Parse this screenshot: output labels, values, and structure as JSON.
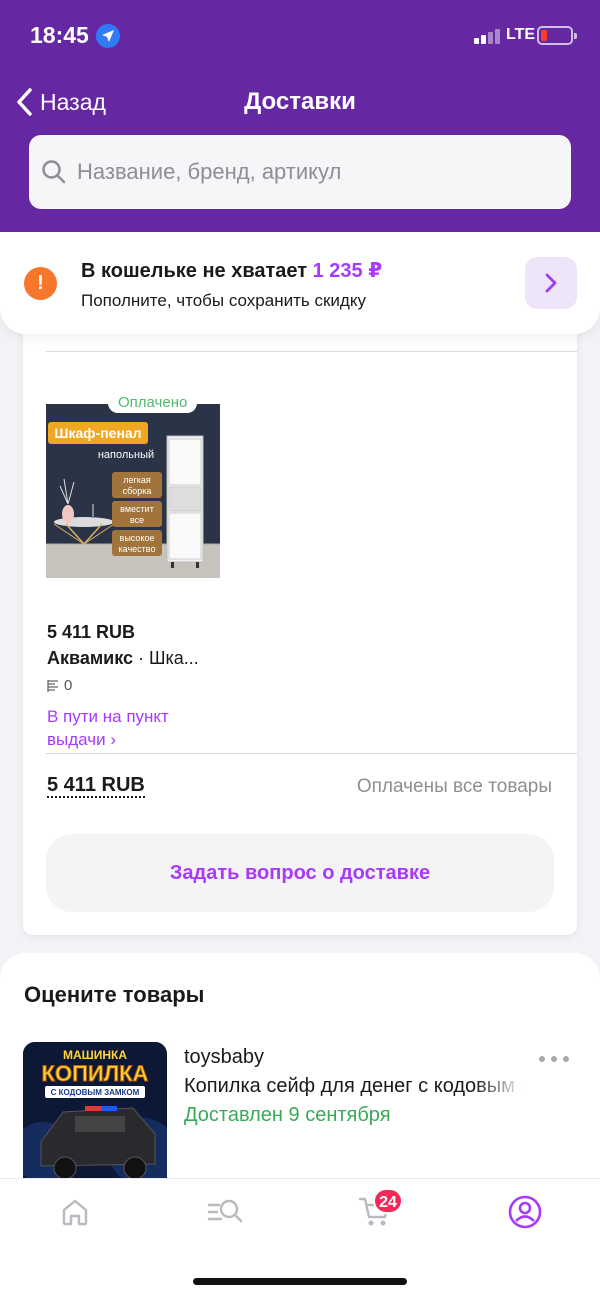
{
  "status_bar": {
    "time": "18:45",
    "network": "LTE"
  },
  "header": {
    "back_label": "Назад",
    "title": "Доставки",
    "search_placeholder": "Название, бренд, артикул"
  },
  "wallet_banner": {
    "title": "В кошельке не хватает",
    "amount": "1 235 ₽",
    "subtitle": "Пополните, чтобы сохранить скидку",
    "icon": "warning-icon"
  },
  "order": {
    "badge": "Оплачено",
    "image_texts": {
      "title": "Шкаф-пенал",
      "subtitle": "напольный",
      "tags": [
        "легкая сборка",
        "вместит все",
        "высокое качество"
      ]
    },
    "price": "5 411 RUB",
    "brand": "Аквамикс",
    "separator": " · ",
    "name": "Шка...",
    "rating_count": "0",
    "status_link": "В пути на пункт выдачи ›",
    "total": "5 411 RUB",
    "payment_status": "Оплачены все товары",
    "ask_button": "Задать вопрос о доставке"
  },
  "rate_section": {
    "title": "Оцените товары",
    "item": {
      "seller": "toysbaby",
      "name": "Копилка сейф для денег с кодовым замком",
      "status": "Доставлен 9 сентября",
      "image_texts": {
        "line1": "МАШИНКА",
        "line2": "КОПИЛКА",
        "line3": "С КОДОВЫМ ЗАМКОМ"
      }
    }
  },
  "tabbar": {
    "items": [
      "home-icon",
      "catalog-search-icon",
      "cart-icon",
      "profile-icon"
    ],
    "cart_badge": "24",
    "active": "profile-icon"
  },
  "colors": {
    "header_bg": "#6627a3",
    "accent": "#a73afd",
    "success": "#4cbb6d",
    "warning": "#f6772c",
    "badge": "#f22959"
  }
}
